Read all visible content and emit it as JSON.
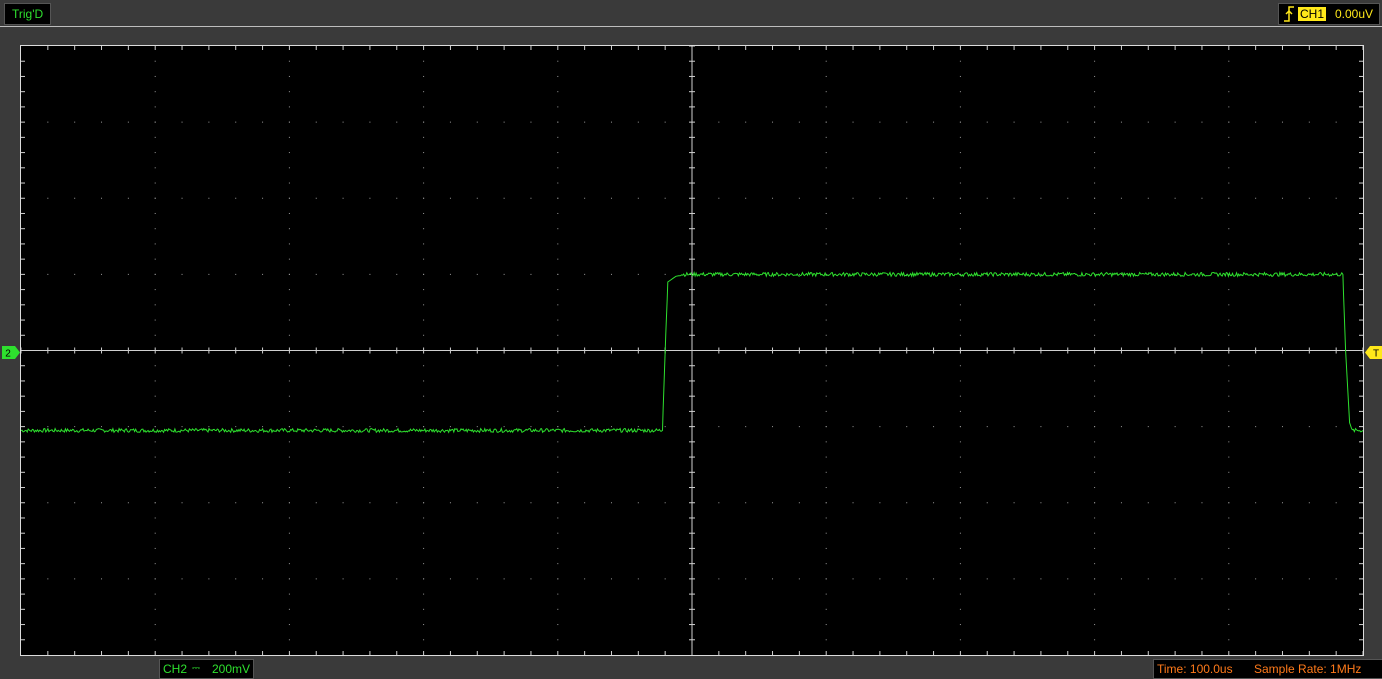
{
  "status": {
    "trigger_state": "Trig'D"
  },
  "trigger": {
    "edge_icon": "rising-edge-icon",
    "source": "CH1",
    "level": "0.00uV",
    "marker_label": "T",
    "color": "#ffe81a"
  },
  "channel2": {
    "marker_label": "2",
    "name": "CH2",
    "coupling_icon": "dc-coupling-icon",
    "coupling_symbol": "⎓",
    "scale": "200mV",
    "color": "#2ee02e"
  },
  "timebase": {
    "time_label": "Time: 100.0us",
    "sample_rate_label": "Sample Rate: 1MHz",
    "color": "#ff7a1a"
  },
  "display": {
    "background": "#000000",
    "grid": true,
    "divisions_x": 10,
    "divisions_y": 8
  },
  "chart_data": {
    "type": "line",
    "units_x": "divisions",
    "units_y": "divisions",
    "xlim": [
      0,
      10
    ],
    "ylim": [
      -4,
      4
    ],
    "grid": true,
    "series": [
      {
        "name": "CH2",
        "color": "#2ee02e",
        "x": [
          0,
          4.78,
          4.8,
          4.82,
          4.9,
          5.0,
          9.85,
          9.87,
          9.9,
          9.92,
          10
        ],
        "y": [
          -1.05,
          -1.05,
          0,
          0.9,
          1.0,
          1.0,
          1.0,
          0,
          -0.95,
          -1.05,
          -1.05
        ]
      }
    ]
  }
}
